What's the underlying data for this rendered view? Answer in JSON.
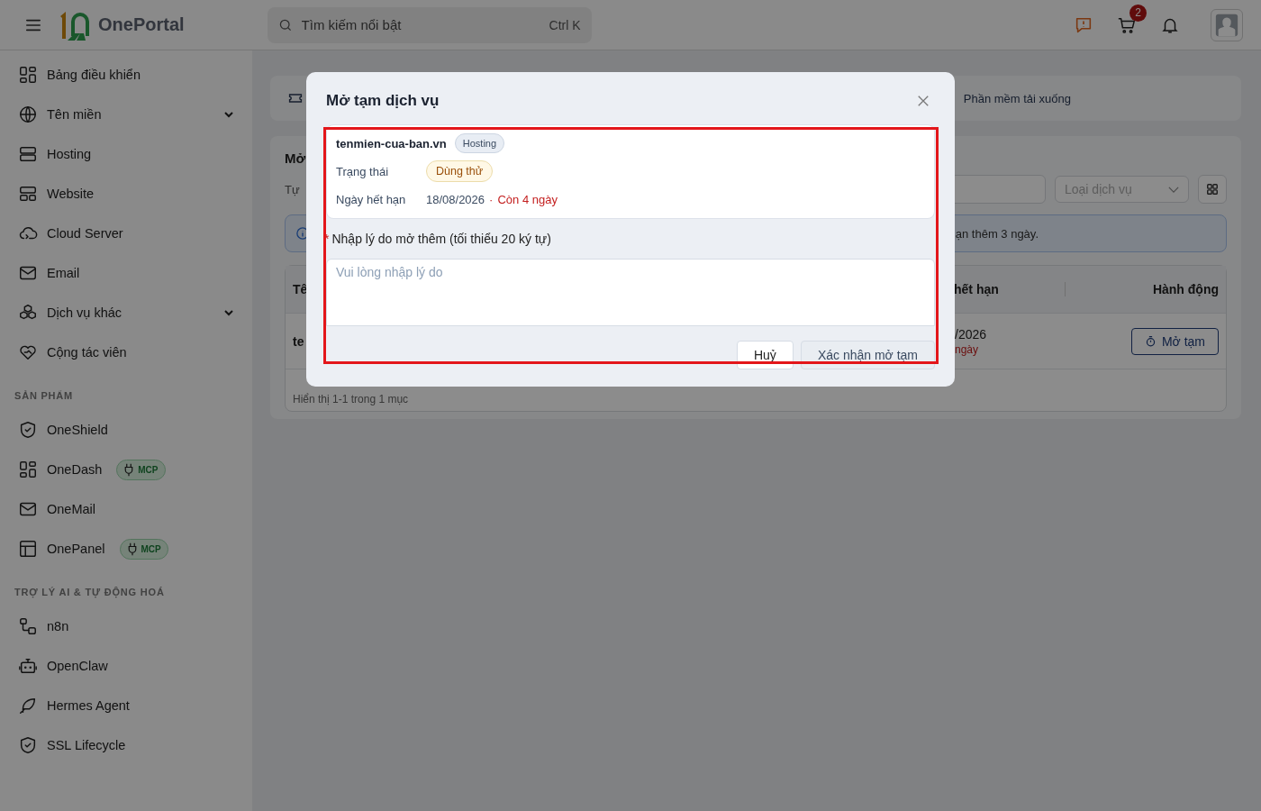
{
  "header": {
    "app_name": "OnePortal",
    "search": {
      "placeholder": "Tìm kiếm nổi bật",
      "shortcut": "Ctrl K"
    },
    "cart_count": "2"
  },
  "sidebar": {
    "groups": [
      {
        "items": [
          {
            "label": "Bảng điều khiển",
            "expandable": false
          },
          {
            "label": "Tên miền",
            "expandable": true
          },
          {
            "label": "Hosting",
            "expandable": false
          },
          {
            "label": "Website",
            "expandable": false
          },
          {
            "label": "Cloud Server",
            "expandable": false
          },
          {
            "label": "Email",
            "expandable": false
          },
          {
            "label": "Dịch vụ khác",
            "expandable": true
          },
          {
            "label": "Cộng tác viên",
            "expandable": false
          }
        ]
      },
      {
        "heading": "SẢN PHẨM",
        "items": [
          {
            "label": "OneShield",
            "expandable": false
          },
          {
            "label": "OneDash",
            "expandable": false,
            "badge": "MCP"
          },
          {
            "label": "OneMail",
            "expandable": false
          },
          {
            "label": "OnePanel",
            "expandable": false,
            "badge": "MCP"
          }
        ]
      },
      {
        "heading": "TRỢ LÝ AI & TỰ ĐỘNG HOÁ",
        "items": [
          {
            "label": "n8n",
            "expandable": false
          },
          {
            "label": "OpenClaw",
            "expandable": false
          },
          {
            "label": "Hermes Agent",
            "expandable": false
          },
          {
            "label": "SSL Lifecycle",
            "expandable": false
          }
        ]
      }
    ]
  },
  "page": {
    "shortcut_card": {
      "label": "Phần mềm tải xuống"
    },
    "panel": {
      "title": "Mở",
      "subtitle": "Tự",
      "filter": {
        "placeholder": "Loại dịch vụ"
      },
      "notice": "ạn thêm 3 ngày.",
      "table": {
        "columns": [
          "Tê",
          "hết hạn",
          "Hành động"
        ],
        "rows": [
          {
            "name": "te",
            "expiry": "/2026",
            "remaining": "ngày",
            "action": "Mở tạm"
          }
        ],
        "footer": "Hiển thị 1-1 trong 1 mục"
      }
    }
  },
  "modal": {
    "title": "Mở tạm dịch vụ",
    "highlighted": true,
    "service": {
      "domain": "tenmien-cua-ban.vn",
      "type": "Hosting",
      "fields": [
        {
          "kind": "badge",
          "label": "Trạng thái",
          "value": "Dùng thử"
        },
        {
          "kind": "date",
          "label": "Ngày hết hạn",
          "value": "18/08/2026",
          "separator": "·",
          "note": "Còn 4 ngày"
        }
      ]
    },
    "reason": {
      "label": "Nhập lý do mở thêm (tối thiểu 20 ký tự)",
      "required_mark": "*",
      "placeholder": "Vui lòng nhập lý do"
    },
    "buttons": {
      "cancel": "Huỷ",
      "confirm": "Xác nhận mở tạm"
    }
  }
}
